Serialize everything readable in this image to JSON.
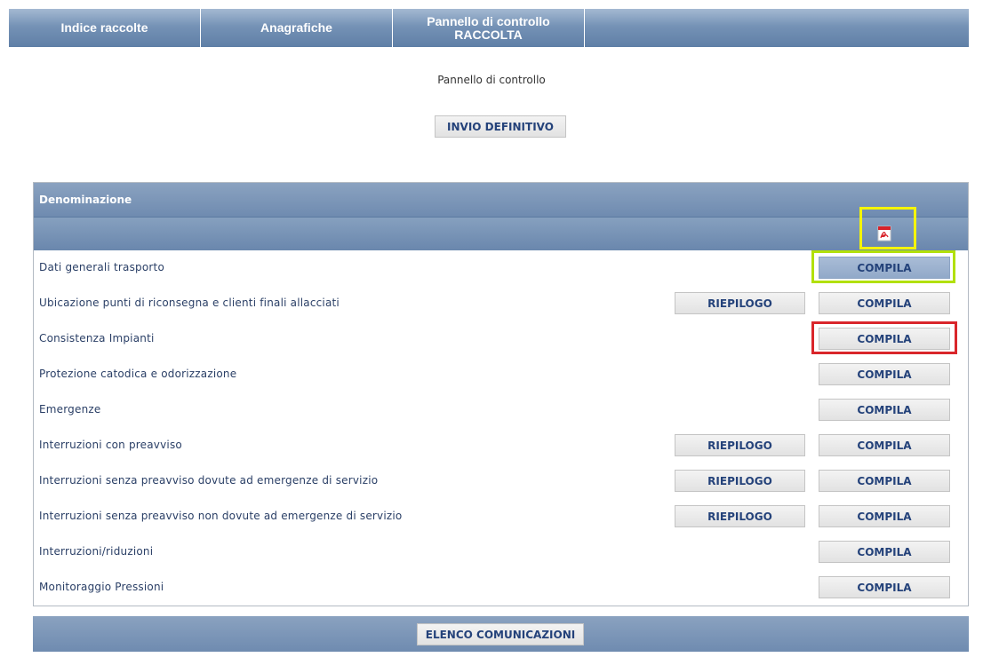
{
  "nav": {
    "items": [
      {
        "label": "Indice raccolte"
      },
      {
        "label": "Anagrafiche"
      },
      {
        "label_line1": "Pannello di controllo",
        "label_line2": "RACCOLTA"
      }
    ]
  },
  "page_title": "Pannello di controllo",
  "invio_button": "INVIO DEFINITIVO",
  "table": {
    "header": "Denominazione",
    "pdf_icon": "pdf-icon",
    "rows": [
      {
        "label": "Dati generali trasporto",
        "riepilogo": "",
        "compila": "COMPILA"
      },
      {
        "label": "Ubicazione punti di riconsegna e clienti finali allacciati",
        "riepilogo": "RIEPILOGO",
        "compila": "COMPILA"
      },
      {
        "label": "Consistenza Impianti",
        "riepilogo": "",
        "compila": "COMPILA"
      },
      {
        "label": "Protezione catodica e odorizzazione",
        "riepilogo": "",
        "compila": "COMPILA"
      },
      {
        "label": "Emergenze",
        "riepilogo": "",
        "compila": "COMPILA"
      },
      {
        "label": "Interruzioni con preavviso",
        "riepilogo": "RIEPILOGO",
        "compila": "COMPILA"
      },
      {
        "label": "Interruzioni senza preavviso dovute ad emergenze di servizio",
        "riepilogo": "RIEPILOGO",
        "compila": "COMPILA"
      },
      {
        "label": "Interruzioni senza preavviso non dovute ad emergenze di servizio",
        "riepilogo": "RIEPILOGO",
        "compila": "COMPILA"
      },
      {
        "label": "Interruzioni/riduzioni",
        "riepilogo": "",
        "compila": "COMPILA"
      },
      {
        "label": "Monitoraggio Pressioni",
        "riepilogo": "",
        "compila": "COMPILA"
      }
    ]
  },
  "footer_button": "ELENCO COMUNICAZIONI",
  "colors": {
    "highlight_yellow": "#f5f500",
    "highlight_green": "#b2e00a",
    "highlight_red": "#d9262b",
    "header_blue": "#6f8bb0"
  }
}
